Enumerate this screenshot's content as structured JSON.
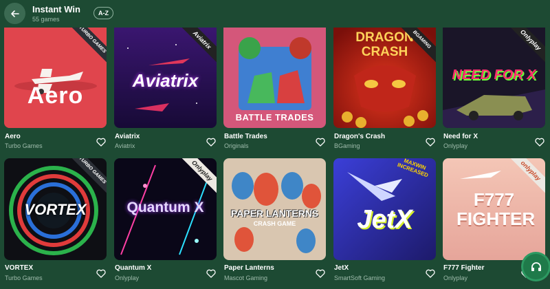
{
  "header": {
    "title": "Instant Win",
    "count": "55 games",
    "sort_label": "A-Z"
  },
  "games": [
    {
      "name": "Aero",
      "provider": "Turbo Games",
      "art_title": "Aero",
      "badge": "TURBO GAMES"
    },
    {
      "name": "Aviatrix",
      "provider": "Aviatrix",
      "art_title": "Aviatrix",
      "badge": "Aviatrix"
    },
    {
      "name": "Battle Trades",
      "provider": "Originals",
      "art_title": "BATTLE TRADES",
      "badge": ""
    },
    {
      "name": "Dragon's Crash",
      "provider": "BGaming",
      "art_title": "DRAGON CRASH",
      "badge": "BGAMING"
    },
    {
      "name": "Need for X",
      "provider": "Onlyplay",
      "art_title": "NEED FOR X",
      "badge": "Onlyplay"
    },
    {
      "name": "VORTEX",
      "provider": "Turbo Games",
      "art_title": "VORTEX",
      "badge": "TURBO GAMES"
    },
    {
      "name": "Quantum X",
      "provider": "Onlyplay",
      "art_title": "Quantum X",
      "badge": "Onlyplay"
    },
    {
      "name": "Paper Lanterns",
      "provider": "Mascot Gaming",
      "art_title": "PAPER LANTERNS",
      "art_sub": "CRASH GAME",
      "badge": ""
    },
    {
      "name": "JetX",
      "provider": "SmartSoft Gaming",
      "art_title": "JetX",
      "art_sub": "MAXWIN INCREASED",
      "badge": ""
    },
    {
      "name": "F777 Fighter",
      "provider": "Onlyplay",
      "art_title": "F777 FIGHTER",
      "badge": "onlyplay"
    }
  ],
  "colors": {
    "background": "#1d4a33",
    "secondary_text": "#9fbcac",
    "button_bg": "#3b6a52",
    "support_button": "#1f7a4a"
  },
  "icons": {
    "back": "arrow-left-icon",
    "favorite": "heart-outline-icon",
    "support": "headset-icon"
  }
}
